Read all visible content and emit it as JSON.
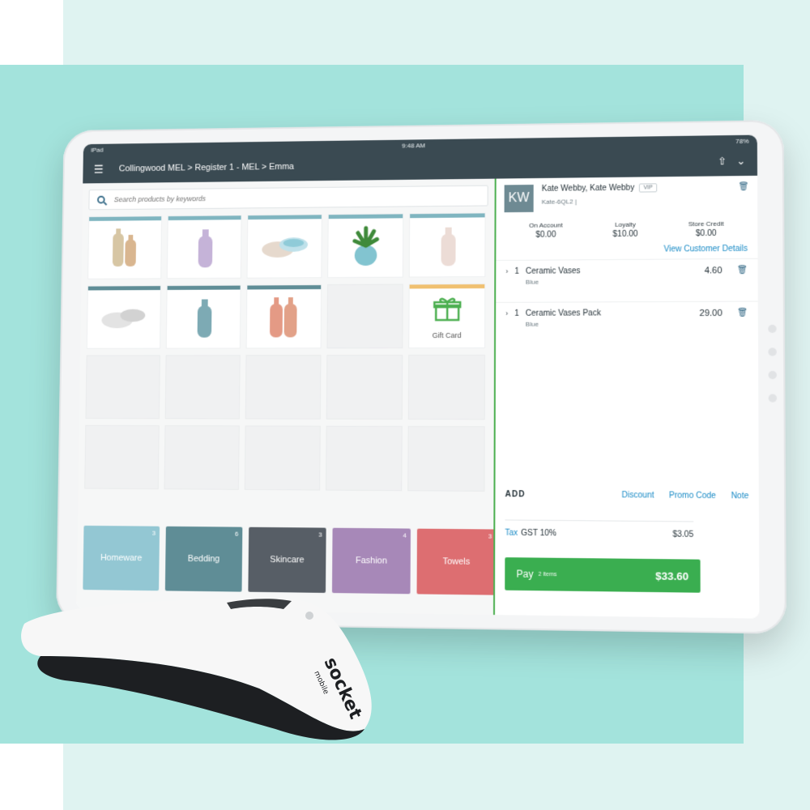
{
  "status_bar": {
    "device": "iPad",
    "time": "9:48 AM",
    "battery": "78%"
  },
  "nav": {
    "breadcrumb": "Collingwood MEL > Register 1 - MEL > Emma"
  },
  "search": {
    "placeholder": "Search products by keywords"
  },
  "gift_card": {
    "label": "Gift Card"
  },
  "categories": [
    {
      "name": "Homeware",
      "count": "3",
      "color": "#93c7d3"
    },
    {
      "name": "Bedding",
      "count": "6",
      "color": "#5f8d96"
    },
    {
      "name": "Skincare",
      "count": "3",
      "color": "#575e66"
    },
    {
      "name": "Fashion",
      "count": "4",
      "color": "#a788b8"
    },
    {
      "name": "Towels",
      "count": "3",
      "color": "#dd6e71"
    }
  ],
  "customer": {
    "initials": "KW",
    "name": "Kate Webby, Kate Webby",
    "badge": "VIP",
    "code": "Kate-6QL2 |",
    "on_account_label": "On Account",
    "on_account_value": "$0.00",
    "loyalty_label": "Loyalty",
    "loyalty_value": "$10.00",
    "store_credit_label": "Store Credit",
    "store_credit_value": "$0.00",
    "view_details": "View Customer Details"
  },
  "cart": {
    "lines": [
      {
        "qty": "1",
        "name": "Ceramic Vases",
        "variant": "Blue",
        "price": "4.60"
      },
      {
        "qty": "1",
        "name": "Ceramic Vases Pack",
        "variant": "Blue",
        "price": "29.00"
      }
    ],
    "add_label": "ADD",
    "discount": "Discount",
    "promo_code": "Promo Code",
    "note": "Note",
    "tax_label": "Tax",
    "tax_name": "GST 10%",
    "tax_amount": "$3.05",
    "pay_label": "Pay",
    "pay_items": "2 items",
    "pay_total": "$33.60"
  },
  "scanner": {
    "brand": "socket",
    "sub": "mobile"
  },
  "colors": {
    "nav": "#3a4a52",
    "accent": "#1a8bc6",
    "pay": "#3aae50",
    "background": "#a3e3dc"
  }
}
